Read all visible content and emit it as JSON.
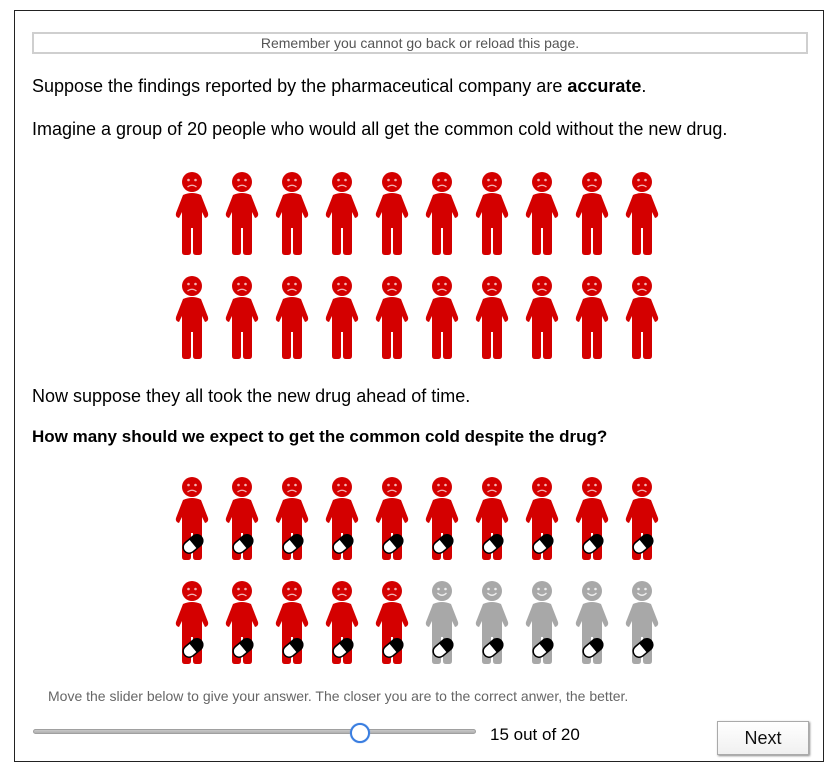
{
  "notice": "Remember you cannot go back or reload this page.",
  "intro": {
    "prefix": "Suppose the findings reported by the pharmaceutical company are ",
    "emphasis": "accurate",
    "suffix": "."
  },
  "imagine": "Imagine a group of 20 people who would all get the common cold without the new drug.",
  "suppose": "Now suppose they all took the new drug ahead of time.",
  "question": "How many should we expect to get the common cold despite the drug?",
  "hint": "Move the slider below to give your answer. The closer you are to the correct anwer, the better.",
  "slider": {
    "value": 15,
    "min": 0,
    "max": 20,
    "label": "15 out of 20"
  },
  "next_label": "Next",
  "icons": {
    "total_people": 20,
    "sick_color": "#d40000",
    "healthy_color": "#a8a8a8",
    "pill_icon": "pill-icon",
    "sick_icon": "sad-person-icon",
    "healthy_icon": "happy-person-icon"
  },
  "colors": {
    "thumb_border": "#3a7ee0",
    "frame_border": "#222222"
  }
}
